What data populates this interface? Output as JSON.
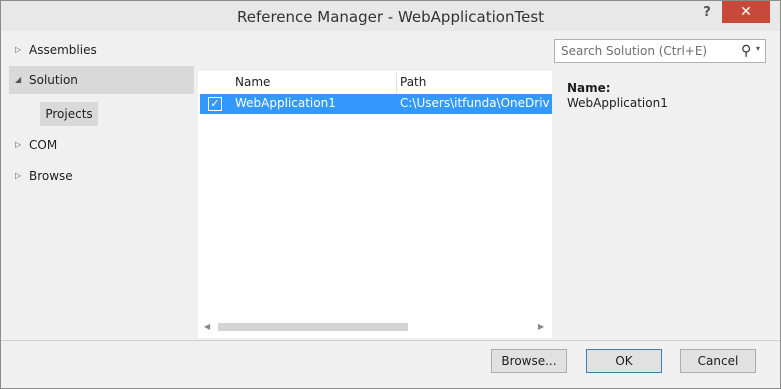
{
  "window": {
    "title": "Reference Manager - WebApplicationTest",
    "help_label": "?",
    "close_label": "✕"
  },
  "nav": {
    "items": [
      {
        "label": "Assemblies",
        "expander": "▷"
      },
      {
        "label": "Solution",
        "expander": "◢"
      },
      {
        "label": "COM",
        "expander": "▷"
      },
      {
        "label": "Browse",
        "expander": "▷"
      }
    ],
    "selected_sub": "Projects"
  },
  "list": {
    "columns": [
      "Name",
      "Path"
    ],
    "rows": [
      {
        "checked": true,
        "name": "WebApplication1",
        "path": "C:\\Users\\itfunda\\OneDriv"
      }
    ]
  },
  "search": {
    "placeholder": "Search Solution (Ctrl+E)",
    "icon": "search-icon"
  },
  "details": {
    "label": "Name:",
    "value": "WebApplication1"
  },
  "buttons": {
    "browse": "Browse...",
    "ok": "OK",
    "cancel": "Cancel"
  },
  "colors": {
    "selection": "#3399ff",
    "close": "#c7493a"
  }
}
